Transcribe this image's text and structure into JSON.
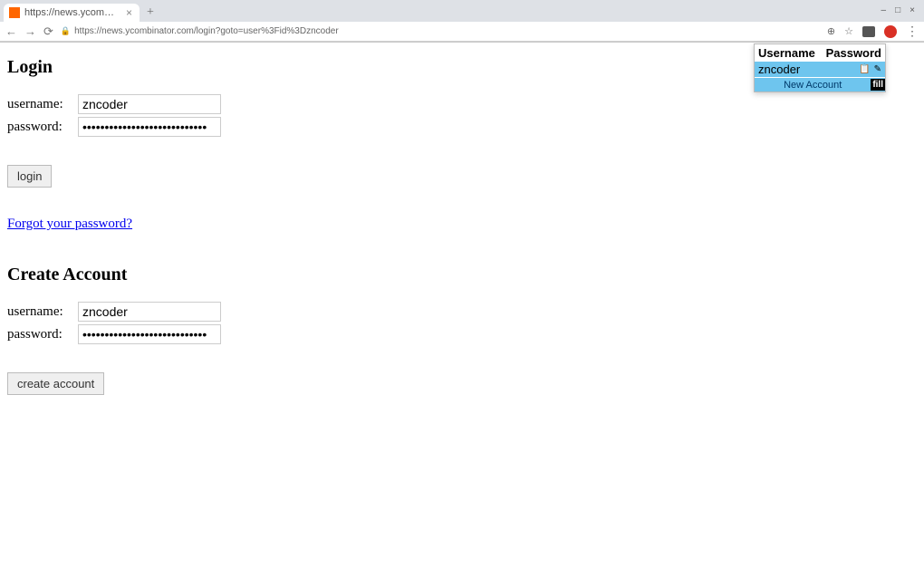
{
  "browser": {
    "tab_title": "https://news.ycombina",
    "url": "https://news.ycombinator.com/login?goto=user%3Fid%3Dzncoder",
    "new_tab_glyph": "+",
    "close_glyph": "×",
    "minimize_glyph": "–",
    "maximize_glyph": "□",
    "win_close_glyph": "×",
    "back_glyph": "←",
    "forward_glyph": "→",
    "reload_glyph": "⟳",
    "lock_glyph": "🔒",
    "search_glyph": "⊕",
    "star_glyph": "☆",
    "menu_glyph": "⋮"
  },
  "login": {
    "heading": "Login",
    "username_label": "username:",
    "username_value": "zncoder",
    "password_label": "password:",
    "password_value": "••••••••••••••••••••••••••••",
    "button_label": "login"
  },
  "forgot_link": "Forgot your password?",
  "create": {
    "heading": "Create Account",
    "username_label": "username:",
    "username_value": "zncoder",
    "password_label": "password:",
    "password_value": "••••••••••••••••••••••••••••",
    "button_label": "create account"
  },
  "pw_popup": {
    "col_username": "Username",
    "col_password": "Password",
    "entry_user": "zncoder",
    "copy_glyph": "📋",
    "reveal_glyph": "✎",
    "new_account": "New Account",
    "fill_label": "fill"
  }
}
